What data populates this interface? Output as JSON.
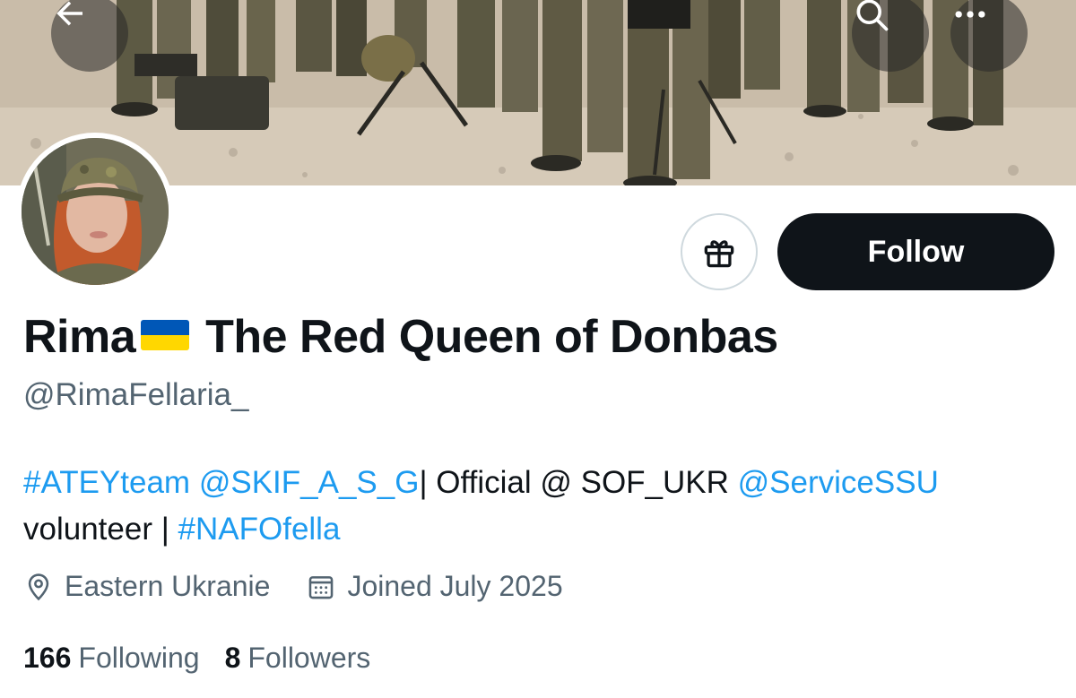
{
  "header": {
    "back_icon": "arrow-left-icon",
    "search_icon": "search-icon",
    "more_icon": "more-horizontal-icon"
  },
  "profile": {
    "name_first": "Rima",
    "flag_icon": "ukraine-flag-icon",
    "name_rest": "The Red Queen of Donbas",
    "handle": "@RimaFellaria_"
  },
  "actions": {
    "gift_icon": "gift-icon",
    "follow_label": "Follow"
  },
  "bio": {
    "link1": "#ATEYteam",
    "space1": " ",
    "link2": "@SKIF_A_S_G",
    "text1": "| Official @ SOF_UKR ",
    "link3": "@ServiceSSU",
    "text2": " volunteer | ",
    "link4": "#NAFOfella"
  },
  "meta": {
    "location": "Eastern Ukranie",
    "joined": "Joined July 2025"
  },
  "stats": {
    "following_count": "166",
    "following_label": "Following",
    "followers_count": "8",
    "followers_label": "Followers"
  },
  "colors": {
    "accent_link": "#1d9bf0",
    "primary_text": "#0f1419",
    "secondary_text": "#536471",
    "follow_bg": "#0f1419",
    "border": "#cfd9de",
    "flag_blue": "#0057b7",
    "flag_yellow": "#ffd700"
  }
}
